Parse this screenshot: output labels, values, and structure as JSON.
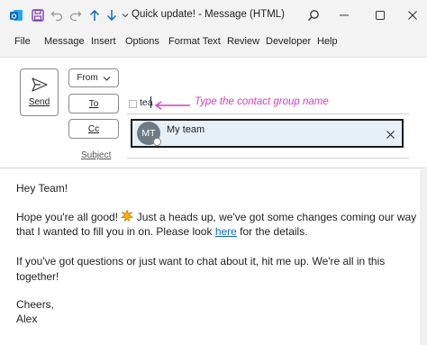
{
  "window": {
    "title": "Quick update!  -  Message (HTML)",
    "app_badge": "O"
  },
  "titlebar_icons": {
    "save": "save-icon",
    "undo": "undo-icon",
    "redo": "redo-icon",
    "up": "arrow-up-icon",
    "down": "arrow-down-icon",
    "more": "chevron-down-icon",
    "search": "search-icon",
    "minimize": "minimize-icon",
    "maximize": "maximize-icon",
    "close": "close-icon"
  },
  "menu": [
    "File",
    "Message",
    "Insert",
    "Options",
    "Format Text",
    "Review",
    "Developer",
    "Help"
  ],
  "compose": {
    "send_label": "Send",
    "from_label": "From",
    "to_label": "To",
    "cc_label": "Cc",
    "subject_label": "Subject",
    "to_value": "tea",
    "callout": "Type the contact group name"
  },
  "autocomplete": {
    "initials": "MT",
    "name": "My team"
  },
  "body": {
    "greeting": "Hey Team!",
    "p1_line1_a": "Hope you're all good! ",
    "p1_line1_b": " Just a heads up, we've got some changes coming our way",
    "p1_line2_a": "that I wanted to fill you in on. Please look ",
    "link": "here",
    "p1_line2_b": " for the details.",
    "p2_line1": "If you've got questions or just want to chat about it, hit me up. We're all in this",
    "p2_line2": "together!",
    "closing": "Cheers,",
    "signature": "Alex"
  },
  "colors": {
    "accent": "#0f6cbd",
    "callout": "#d63fbd",
    "link": "#0f6cbd"
  }
}
